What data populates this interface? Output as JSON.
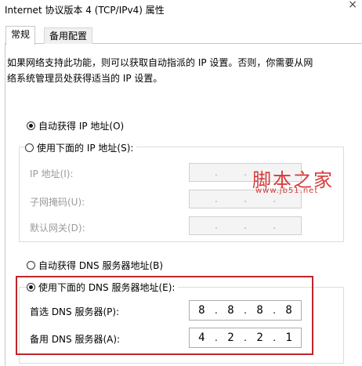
{
  "window": {
    "title": "Internet 协议版本 4 (TCP/IPv4) 属性",
    "close_glyph": "×"
  },
  "tabs": [
    {
      "label": "常规",
      "active": true
    },
    {
      "label": "备用配置",
      "active": false
    }
  ],
  "description_lines": [
    "如果网络支持此功能，则可以获取自动指派的 IP 设置。否则，你需要从网",
    "络系统管理员处获得适当的 IP 设置。"
  ],
  "ip_section": {
    "auto_label": "自动获得 IP 地址(O)",
    "auto_checked": true,
    "manual_label": "使用下面的 IP 地址(S):",
    "manual_checked": false,
    "fields": [
      {
        "label": "IP 地址(I):",
        "octets": [
          "",
          "",
          "",
          ""
        ]
      },
      {
        "label": "子网掩码(U):",
        "octets": [
          "",
          "",
          "",
          ""
        ]
      },
      {
        "label": "默认网关(D):",
        "octets": [
          "",
          "",
          "",
          ""
        ]
      }
    ]
  },
  "dns_section": {
    "auto_label": "自动获得 DNS 服务器地址(B)",
    "auto_checked": false,
    "manual_label": "使用下面的 DNS 服务器地址(E):",
    "manual_checked": true,
    "preferred": {
      "label": "首选 DNS 服务器(P):",
      "octets": [
        "8",
        "8",
        "8",
        "8"
      ]
    },
    "alternate": {
      "label": "备用 DNS 服务器(A):",
      "octets": [
        "4",
        "2",
        "2",
        "1"
      ]
    }
  },
  "highlight_color": "#c0252b",
  "watermark": {
    "text": "脚本之家",
    "url": "www.jb51.net",
    "color": "#d63b3b"
  }
}
